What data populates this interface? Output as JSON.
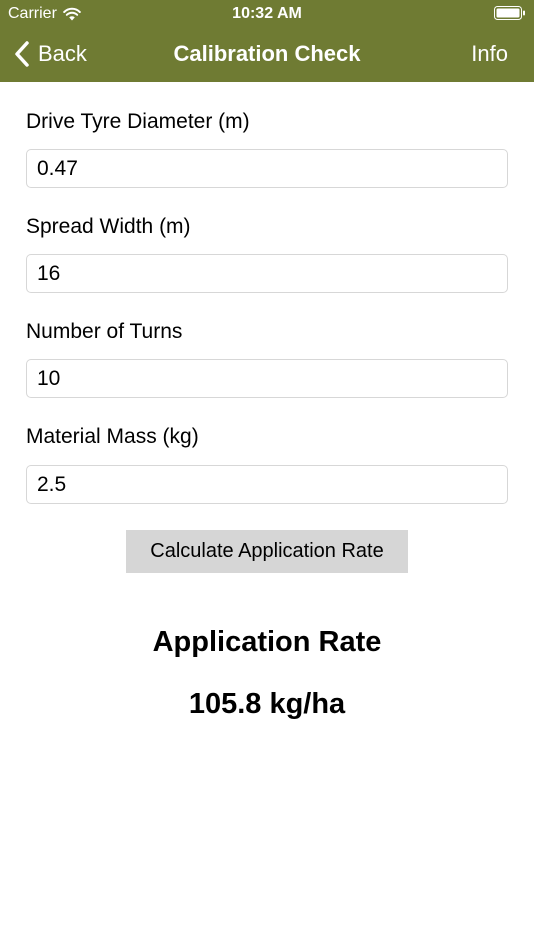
{
  "status_bar": {
    "carrier": "Carrier",
    "time": "10:32 AM"
  },
  "nav": {
    "back_label": "Back",
    "title": "Calibration Check",
    "info_label": "Info"
  },
  "form": {
    "tyre_diameter": {
      "label": "Drive Tyre Diameter (m)",
      "value": "0.47"
    },
    "spread_width": {
      "label": "Spread Width (m)",
      "value": "16"
    },
    "turns": {
      "label": "Number of Turns",
      "value": "10"
    },
    "mass": {
      "label": "Material Mass (kg)",
      "value": "2.5"
    }
  },
  "calculate_label": "Calculate Application Rate",
  "result": {
    "title": "Application Rate",
    "value": "105.8 kg/ha"
  },
  "colors": {
    "header_bg": "#6f7b33",
    "button_bg": "#d6d6d6"
  },
  "icons": {
    "wifi": "wifi-icon",
    "battery": "battery-icon",
    "back": "chevron-left-icon"
  }
}
